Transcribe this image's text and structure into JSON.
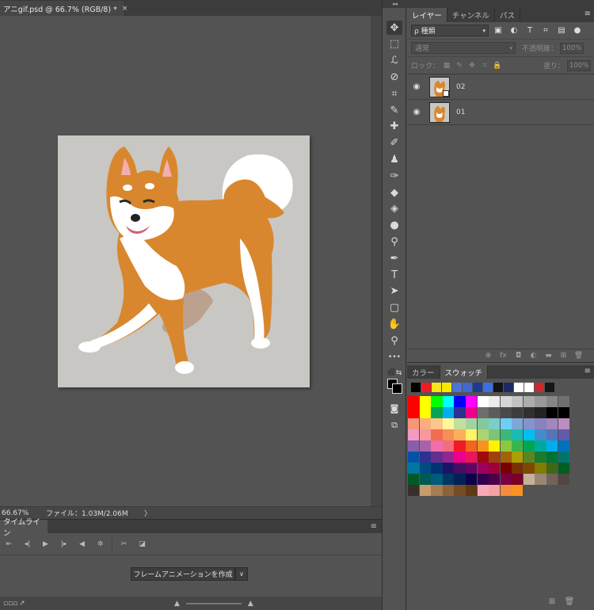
{
  "document": {
    "tab_title": "アニgif.psd @ 66.7% (RGB/8) *",
    "close_glyph": "×"
  },
  "status": {
    "zoom": "66.67%",
    "file_info": "ファイル：1.03M/2.06M",
    "arrow": "〉"
  },
  "timeline": {
    "tab_label": "タイムライン",
    "menu_glyph": "≡",
    "controls": [
      "⇤",
      "◂|",
      "▶",
      "|▸",
      "◀",
      "✲",
      "✂",
      "◪"
    ],
    "create_button": "フレームアニメーションを作成",
    "dropdown_glyph": "∨"
  },
  "tools": [
    {
      "name": "move-tool-icon",
      "glyph": "✥"
    },
    {
      "name": "marquee-tool-icon",
      "glyph": "⬚"
    },
    {
      "name": "lasso-tool-icon",
      "glyph": "ℒ"
    },
    {
      "name": "quick-select-tool-icon",
      "glyph": "⊘"
    },
    {
      "name": "crop-tool-icon",
      "glyph": "⌗"
    },
    {
      "name": "eyedropper-tool-icon",
      "glyph": "✎"
    },
    {
      "name": "healing-brush-icon",
      "glyph": "✚"
    },
    {
      "name": "brush-tool-icon",
      "glyph": "✐"
    },
    {
      "name": "stamp-tool-icon",
      "glyph": "♟"
    },
    {
      "name": "history-brush-icon",
      "glyph": "✑"
    },
    {
      "name": "eraser-tool-icon",
      "glyph": "◆"
    },
    {
      "name": "paint-bucket-icon",
      "glyph": "◈"
    },
    {
      "name": "blur-tool-icon",
      "glyph": "●"
    },
    {
      "name": "dodge-tool-icon",
      "glyph": "⚲"
    },
    {
      "name": "pen-tool-icon",
      "glyph": "✒"
    },
    {
      "name": "type-tool-icon",
      "glyph": "T"
    },
    {
      "name": "path-select-icon",
      "glyph": "➤"
    },
    {
      "name": "shape-tool-icon",
      "glyph": "▢"
    },
    {
      "name": "hand-tool-icon",
      "glyph": "✋"
    },
    {
      "name": "zoom-tool-icon",
      "glyph": "⚲"
    },
    {
      "name": "more-tools-icon",
      "glyph": "•••"
    }
  ],
  "layers_panel": {
    "tabs": [
      "レイヤー",
      "チャンネル",
      "パス"
    ],
    "menu_glyph": "≡",
    "kind_label": "ρ 種類",
    "filter_icons": [
      "▣",
      "◐",
      "T",
      "⌗",
      "▤",
      "●"
    ],
    "blend_mode": "通常",
    "opacity_label": "不透明度：",
    "opacity_value": "100%",
    "lock_label": "ロック：",
    "lock_icons": [
      "▦",
      "✎",
      "✥",
      "⌗",
      "🔒"
    ],
    "fill_label": "塗り：",
    "fill_value": "100%",
    "layers": [
      {
        "name": "02",
        "visible_glyph": "👁"
      },
      {
        "name": "01",
        "visible_glyph": "👁"
      }
    ],
    "footer_icons": [
      "⊕",
      "fx",
      "◘",
      "◐",
      "▬",
      "⊞",
      "🗑"
    ]
  },
  "swatch_panel": {
    "tabs": [
      "カラー",
      "スウォッチ"
    ],
    "menu_glyph": "≡",
    "recent": [
      "#000000",
      "#ee1c24",
      "#f7e41b",
      "#f5e900",
      "#4c73d6",
      "#4267d1",
      "#1a3b8f",
      "#3d6fe0",
      "#141414",
      "#1d2a63",
      "#ffffff",
      "#ffffff",
      "#c9292f",
      "#161616"
    ],
    "colors": [
      "#ff0000",
      "#ffff00",
      "#00ff00",
      "#00ffff",
      "#0000ff",
      "#ff00ff",
      "#ffffff",
      "#ebebeb",
      "#d6d6d6",
      "#c2c2c2",
      "#adadad",
      "#999999",
      "#858585",
      "#707070",
      "#ff0000",
      "#ffff00",
      "#00a651",
      "#00aeef",
      "#2e3192",
      "#ec008c",
      "#6d6d6d",
      "#5c5c5c",
      "#4a4a4a",
      "#3d3d3d",
      "#303030",
      "#232323",
      "#000000",
      "#000000",
      "#f7977a",
      "#f9ad81",
      "#fdc68a",
      "#fff79a",
      "#c4df9b",
      "#a3d39c",
      "#82ca9d",
      "#7bcdc8",
      "#6ecff6",
      "#7ea7d8",
      "#8493ca",
      "#8882be",
      "#a187be",
      "#bc8dbf",
      "#f49ac2",
      "#f6989d",
      "#f26c4f",
      "#f68e56",
      "#fbaf5d",
      "#fff568",
      "#acd372",
      "#7cc576",
      "#3bb878",
      "#1abbb4",
      "#00bff3",
      "#438ccb",
      "#5574b9",
      "#605ca8",
      "#855fa8",
      "#a763a8",
      "#f06ea9",
      "#f26d7d",
      "#ed1c24",
      "#f26522",
      "#f7941d",
      "#fff200",
      "#8dc63f",
      "#39b54a",
      "#00a651",
      "#00a99d",
      "#00aeef",
      "#0072bc",
      "#0054a6",
      "#2e3192",
      "#662d91",
      "#92278f",
      "#ec008c",
      "#ed145b",
      "#9e0b0f",
      "#a0410d",
      "#a36209",
      "#aba000",
      "#598527",
      "#197b30",
      "#007236",
      "#00746b",
      "#0076a3",
      "#004b80",
      "#003471",
      "#1b1464",
      "#440e62",
      "#630460",
      "#9e005d",
      "#9e0039",
      "#790000",
      "#7b2e00",
      "#7d4900",
      "#827b00",
      "#406618",
      "#005e20",
      "#005826",
      "#005952",
      "#005b7f",
      "#003663",
      "#002157",
      "#0d004c",
      "#32004b",
      "#4b0049",
      "#7b0046",
      "#7a0026",
      "#c7b299",
      "#998675",
      "#736357",
      "#534741",
      "#37302a",
      "#c69c6d",
      "#a67c52",
      "#8c6239",
      "#754c24",
      "#603913",
      "#f7a8b8",
      "#f4a1a1",
      "#f58c3b",
      "#f7931e"
    ],
    "footer_icons": [
      "▬",
      "⊞",
      "🗑"
    ]
  }
}
